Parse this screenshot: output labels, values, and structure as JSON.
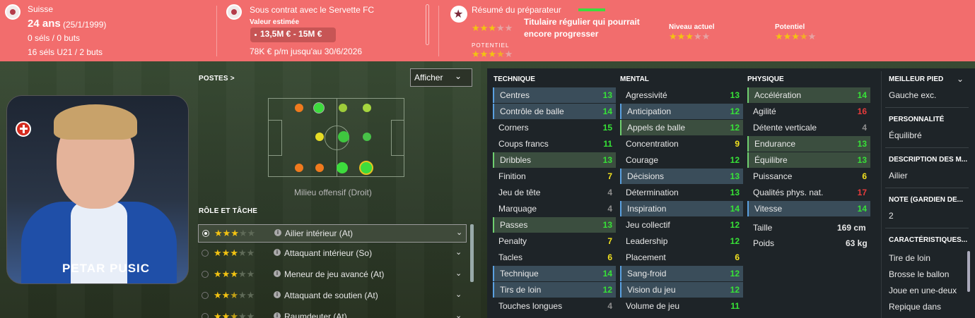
{
  "header": {
    "nationality": "Suisse",
    "age": "24 ans",
    "birth": "(25/1/1999)",
    "caps": "0 séls / 0 buts",
    "u21": "16 séls U21 / 2 buts",
    "contract": "Sous contrat avec le Servette FC",
    "value_label": "Valeur estimée",
    "value": "13,5M € - 15M €",
    "wage": "78K € p/m jusqu'au 30/6/2026",
    "scout_title": "Résumé du préparateur",
    "scout_summary": "Titulaire régulier qui pourrait encore progresser",
    "potential_small_label": "POTENTIEL",
    "current_level_label": "Niveau actuel",
    "potential_label": "Potentiel",
    "scout_current_stars": 3,
    "scout_potential_stars": 3.5,
    "current_level_stars": 3,
    "potential_stars": 3.5,
    "accent_color": "#f26d6d"
  },
  "card": {
    "player_name": "PETAR PUSIC",
    "flag_icon": "swiss-flag-icon"
  },
  "positions": {
    "title": "POSTES >",
    "display_button": "Afficher",
    "selected_position": "Milieu offensif (Droit)"
  },
  "roles": {
    "title": "RÔLE ET TÂCHE",
    "items": [
      {
        "name": "Ailier intérieur (At)",
        "stars": 3
      },
      {
        "name": "Attaquant intérieur (So)",
        "stars": 3
      },
      {
        "name": "Meneur de jeu avancé (At)",
        "stars": 3
      },
      {
        "name": "Attaquant de soutien (At)",
        "stars": 2.5
      },
      {
        "name": "Raumdeuter (At)",
        "stars": 2.5
      }
    ]
  },
  "attributes": {
    "technique_title": "TECHNIQUE",
    "mental_title": "MENTAL",
    "physique_title": "PHYSIQUE",
    "technique": [
      {
        "name": "Centres",
        "value": "13"
      },
      {
        "name": "Contrôle de balle",
        "value": "14"
      },
      {
        "name": "Corners",
        "value": "15"
      },
      {
        "name": "Coups francs",
        "value": "11"
      },
      {
        "name": "Dribbles",
        "value": "13"
      },
      {
        "name": "Finition",
        "value": "7"
      },
      {
        "name": "Jeu de tête",
        "value": "4"
      },
      {
        "name": "Marquage",
        "value": "4"
      },
      {
        "name": "Passes",
        "value": "13"
      },
      {
        "name": "Penalty",
        "value": "7"
      },
      {
        "name": "Tacles",
        "value": "6"
      },
      {
        "name": "Technique",
        "value": "14"
      },
      {
        "name": "Tirs de loin",
        "value": "12"
      },
      {
        "name": "Touches longues",
        "value": "4"
      }
    ],
    "mental": [
      {
        "name": "Agressivité",
        "value": "13"
      },
      {
        "name": "Anticipation",
        "value": "12"
      },
      {
        "name": "Appels de balle",
        "value": "12"
      },
      {
        "name": "Concentration",
        "value": "9"
      },
      {
        "name": "Courage",
        "value": "12"
      },
      {
        "name": "Décisions",
        "value": "13"
      },
      {
        "name": "Détermination",
        "value": "13"
      },
      {
        "name": "Inspiration",
        "value": "14"
      },
      {
        "name": "Jeu collectif",
        "value": "12"
      },
      {
        "name": "Leadership",
        "value": "12"
      },
      {
        "name": "Placement",
        "value": "6"
      },
      {
        "name": "Sang-froid",
        "value": "12"
      },
      {
        "name": "Vision du jeu",
        "value": "12"
      },
      {
        "name": "Volume de jeu",
        "value": "11"
      }
    ],
    "physique": [
      {
        "name": "Accélération",
        "value": "14"
      },
      {
        "name": "Agilité",
        "value": "16"
      },
      {
        "name": "Détente verticale",
        "value": "4"
      },
      {
        "name": "Endurance",
        "value": "13"
      },
      {
        "name": "Équilibre",
        "value": "13"
      },
      {
        "name": "Puissance",
        "value": "6"
      },
      {
        "name": "Qualités phys. nat.",
        "value": "17"
      },
      {
        "name": "Vitesse",
        "value": "14"
      }
    ],
    "height_label": "Taille",
    "height": "169 cm",
    "weight_label": "Poids",
    "weight": "63 kg"
  },
  "info": {
    "foot_label": "MEILLEUR PIED",
    "foot": "Gauche exc.",
    "personality_label": "PERSONNALITÉ",
    "personality": "Équilibré",
    "description_label": "DESCRIPTION DES M...",
    "description": "Ailier",
    "note_label": "NOTE (GARDIEN DE...",
    "note": "2",
    "traits_label": "CARACTÉRISTIQUES...",
    "traits": [
      "Tire de loin",
      "Brosse le ballon",
      "Joue en une-deux",
      "Repique dans"
    ]
  }
}
